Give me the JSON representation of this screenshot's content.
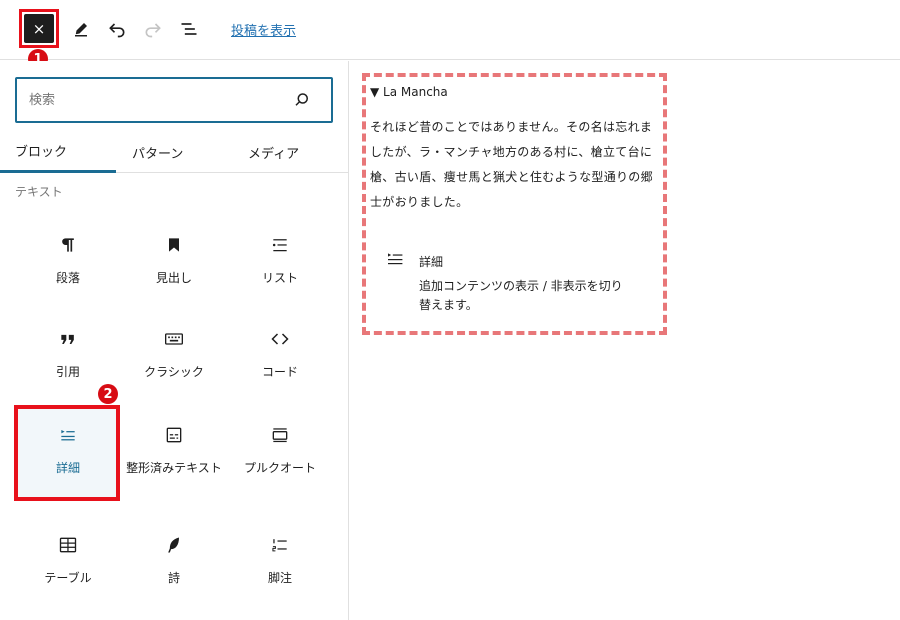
{
  "toolbar": {
    "close_label": "×",
    "view_post_link": "投稿を表示",
    "annotation_number": "1"
  },
  "sidebar": {
    "search": {
      "placeholder": "検索",
      "value": ""
    },
    "tabs": [
      {
        "label": "ブロック",
        "active": true
      },
      {
        "label": "パターン",
        "active": false
      },
      {
        "label": "メディア",
        "active": false
      }
    ],
    "category_label": "テキスト",
    "blocks": [
      {
        "label": "段落",
        "icon": "paragraph-icon"
      },
      {
        "label": "見出し",
        "icon": "bookmark-heading-icon"
      },
      {
        "label": "リスト",
        "icon": "list-icon"
      },
      {
        "label": "引用",
        "icon": "quote-icon"
      },
      {
        "label": "クラシック",
        "icon": "keyboard-icon"
      },
      {
        "label": "コード",
        "icon": "code-icon"
      },
      {
        "label": "詳細",
        "icon": "details-icon",
        "selected": true
      },
      {
        "label": "整形済みテキスト",
        "icon": "preformatted-icon"
      },
      {
        "label": "プルクオート",
        "icon": "pullquote-icon"
      },
      {
        "label": "テーブル",
        "icon": "table-icon"
      },
      {
        "label": "詩",
        "icon": "feather-verse-icon"
      },
      {
        "label": "脚注",
        "icon": "footnotes-icon"
      }
    ],
    "annotation_number": "2"
  },
  "preview": {
    "summary": "▼ La Mancha",
    "paragraph_lines": [
      "それほど昔のことではありません。その名は忘れま",
      "したが、ラ・マンチャ地方のある村に、槍立て台に",
      "槍、古い盾、痩せ馬と猟犬と住むような型通りの郷",
      "士がおりました。"
    ],
    "info_title": "詳細",
    "info_desc_lines": [
      "追加コンテンツの表示 / 非表示を切り",
      "替えます。"
    ]
  },
  "colors": {
    "accent": "#1a6c93",
    "highlight_red": "#e8111b",
    "dashed_border": "#e87779",
    "badge_red": "#d70c14"
  }
}
